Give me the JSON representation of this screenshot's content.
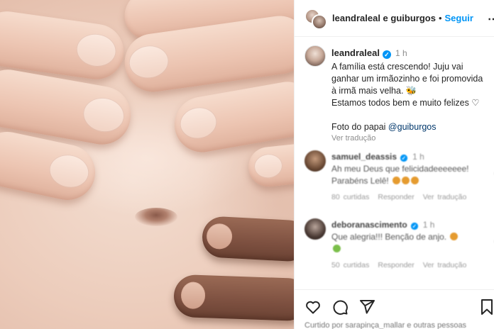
{
  "post": {
    "photo_alt_icon": "belly-photo",
    "header": {
      "authors": "leandraleal e guiburgos",
      "separator": "•",
      "follow_label": "Seguir",
      "more_icon": "more-horizontal-icon"
    },
    "caption": {
      "username": "leandraleal",
      "verified_icon": "verified-badge-icon",
      "time": "1 h",
      "lines": [
        "A família está crescendo! Juju vai",
        "ganhar um irmãozinho e foi promovida",
        "à irmã mais velha. 🐝",
        "Estamos todos bem e muito felizes ♡"
      ],
      "credit_prefix": "Foto do papai ",
      "credit_mention": "@guiburgos",
      "see_translation": "Ver tradução"
    },
    "comments": [
      {
        "username": "samuel_deassis",
        "time": "1 h",
        "text_lines": [
          "Ah meu Deus que felicidadeeeeeee!",
          "Parabéns Lelê!"
        ],
        "meta": [
          "80 curtidas",
          "Responder",
          "Ver tradução"
        ]
      },
      {
        "username": "deboranascimento",
        "time": "1 h",
        "text_lines": [
          "Que alegria!!! Benção de anjo.",
          ""
        ],
        "meta": [
          "50 curtidas",
          "Responder",
          "Ver tradução"
        ]
      }
    ],
    "actions": {
      "like_icon": "heart-icon",
      "comment_icon": "comment-icon",
      "share_icon": "share-icon",
      "save_icon": "bookmark-icon",
      "likes_text": "Curtido por sarapinça_mallar e outras pessoas"
    },
    "colors": {
      "accent": "#0095f6",
      "mention": "#00376b"
    }
  }
}
